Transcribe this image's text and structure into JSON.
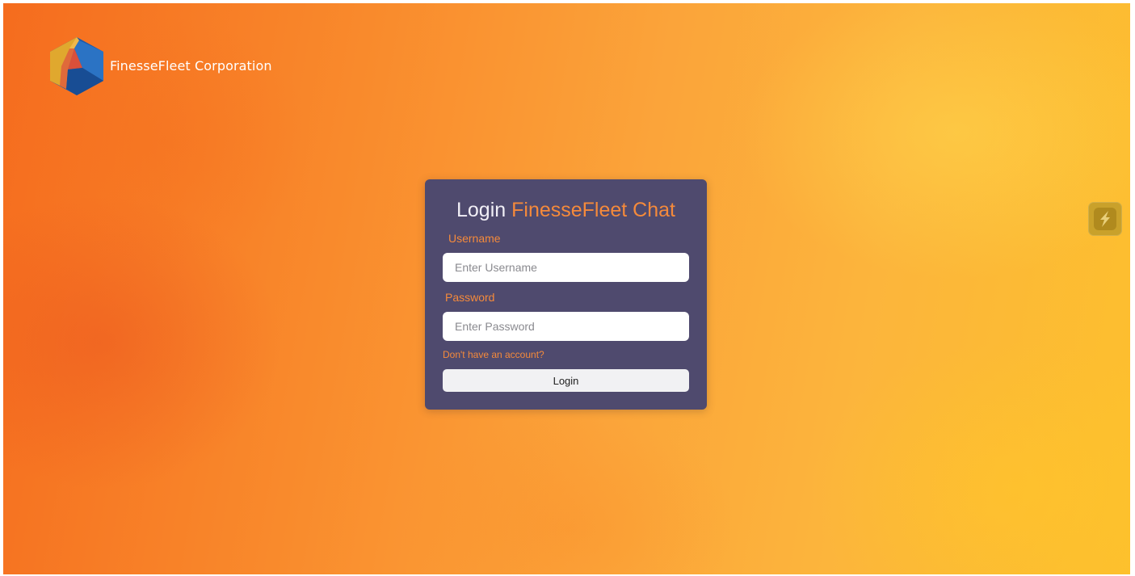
{
  "brand": {
    "name": "FinesseFleet Corporation",
    "logo_icon": "cube-logo-icon"
  },
  "login_card": {
    "title_main": "Login",
    "title_accent": "FinesseFleet Chat",
    "username": {
      "label": "Username",
      "placeholder": "Enter Username",
      "value": ""
    },
    "password": {
      "label": "Password",
      "placeholder": "Enter Password",
      "value": ""
    },
    "signup_link": "Don't have an account?",
    "login_button": "Login"
  },
  "side_widget": {
    "icon": "lightning-bolt-icon"
  },
  "colors": {
    "card_background": "#4f4a6e",
    "accent": "#f58a3b",
    "background_orange": "#f98a2c",
    "background_yellow": "#fdc02d",
    "widget": "#c9a12b"
  }
}
